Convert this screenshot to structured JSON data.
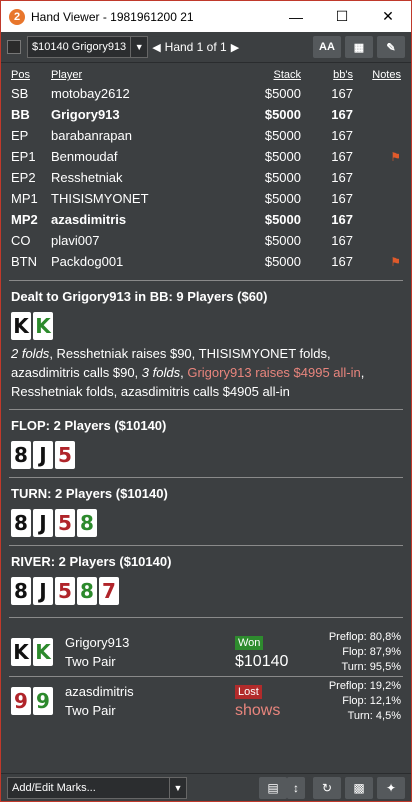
{
  "window": {
    "app_icon": "2",
    "title": "Hand Viewer - 1981961200 21"
  },
  "toolbar": {
    "tournament_select": "$10140 Grigory913",
    "hand_label": "Hand 1 of 1",
    "font_button": "AA"
  },
  "table": {
    "headers": {
      "pos": "Pos",
      "player": "Player",
      "stack": "Stack",
      "bbs": "bb's",
      "notes": "Notes"
    },
    "rows": [
      {
        "pos": "SB",
        "player": "motobay2612",
        "stack": "$5000",
        "bbs": "167",
        "bold": false,
        "flag": false
      },
      {
        "pos": "BB",
        "player": "Grigory913",
        "stack": "$5000",
        "bbs": "167",
        "bold": true,
        "flag": false
      },
      {
        "pos": "EP",
        "player": "barabanrapan",
        "stack": "$5000",
        "bbs": "167",
        "bold": false,
        "flag": false
      },
      {
        "pos": "EP1",
        "player": "Benmoudaf",
        "stack": "$5000",
        "bbs": "167",
        "bold": false,
        "flag": true
      },
      {
        "pos": "EP2",
        "player": "Resshetniak",
        "stack": "$5000",
        "bbs": "167",
        "bold": false,
        "flag": false
      },
      {
        "pos": "MP1",
        "player": "THISISMYONET",
        "stack": "$5000",
        "bbs": "167",
        "bold": false,
        "flag": false
      },
      {
        "pos": "MP2",
        "player": "azasdimitris",
        "stack": "$5000",
        "bbs": "167",
        "bold": true,
        "flag": false
      },
      {
        "pos": "CO",
        "player": "plavi007",
        "stack": "$5000",
        "bbs": "167",
        "bold": false,
        "flag": false
      },
      {
        "pos": "BTN",
        "player": "Packdog001",
        "stack": "$5000",
        "bbs": "167",
        "bold": false,
        "flag": true
      }
    ]
  },
  "preflop": {
    "title": "Dealt to Grigory913 in BB: 9 Players ($60)",
    "cards": [
      {
        "rank": "K",
        "color": "black"
      },
      {
        "rank": "K",
        "color": "green"
      }
    ],
    "action": {
      "p1": "2 folds",
      "p2": ", Resshetniak raises $90, THISISMYONET folds, azasdimitris calls $90, ",
      "p3": "3 folds",
      "p4": ", ",
      "p5": "Grigory913 raises $4995 all-in",
      "p6": ", Resshetniak folds, azasdimitris calls $4905 all-in"
    }
  },
  "flop": {
    "title": "FLOP: 2 Players ($10140)",
    "cards": [
      {
        "rank": "8",
        "color": "black"
      },
      {
        "rank": "J",
        "color": "black"
      },
      {
        "rank": "5",
        "color": "red"
      }
    ]
  },
  "turn": {
    "title": "TURN: 2 Players ($10140)",
    "cards": [
      {
        "rank": "8",
        "color": "black"
      },
      {
        "rank": "J",
        "color": "black"
      },
      {
        "rank": "5",
        "color": "red"
      },
      {
        "rank": "8",
        "color": "green"
      }
    ]
  },
  "river": {
    "title": "RIVER: 2 Players ($10140)",
    "cards": [
      {
        "rank": "8",
        "color": "black"
      },
      {
        "rank": "J",
        "color": "black"
      },
      {
        "rank": "5",
        "color": "red"
      },
      {
        "rank": "8",
        "color": "green"
      },
      {
        "rank": "7",
        "color": "red"
      }
    ]
  },
  "results": [
    {
      "cards": [
        {
          "rank": "K",
          "color": "black"
        },
        {
          "rank": "K",
          "color": "green"
        }
      ],
      "name": "Grigory913",
      "hand": "Two Pair",
      "badge": "Won",
      "amount": "$10140",
      "eq": [
        {
          "label": "Preflop:",
          "value": "80,8%"
        },
        {
          "label": "Flop:",
          "value": "87,9%"
        },
        {
          "label": "Turn:",
          "value": "95,5%"
        }
      ]
    },
    {
      "cards": [
        {
          "rank": "9",
          "color": "red"
        },
        {
          "rank": "9",
          "color": "green"
        }
      ],
      "name": "azasdimitris",
      "hand": "Two Pair",
      "badge": "Lost",
      "amount": "shows",
      "eq": [
        {
          "label": "Preflop:",
          "value": "19,2%"
        },
        {
          "label": "Flop:",
          "value": "12,1%"
        },
        {
          "label": "Turn:",
          "value": "4,5%"
        }
      ]
    }
  ],
  "bottom": {
    "marks_label": "Add/Edit Marks..."
  },
  "colors": {
    "border": "#c0392b",
    "background": "#3c3f41",
    "won": "#2e8b2e",
    "lost": "#b22b2b",
    "all_in_text": "#e8857d",
    "flag": "#e05a2b"
  }
}
